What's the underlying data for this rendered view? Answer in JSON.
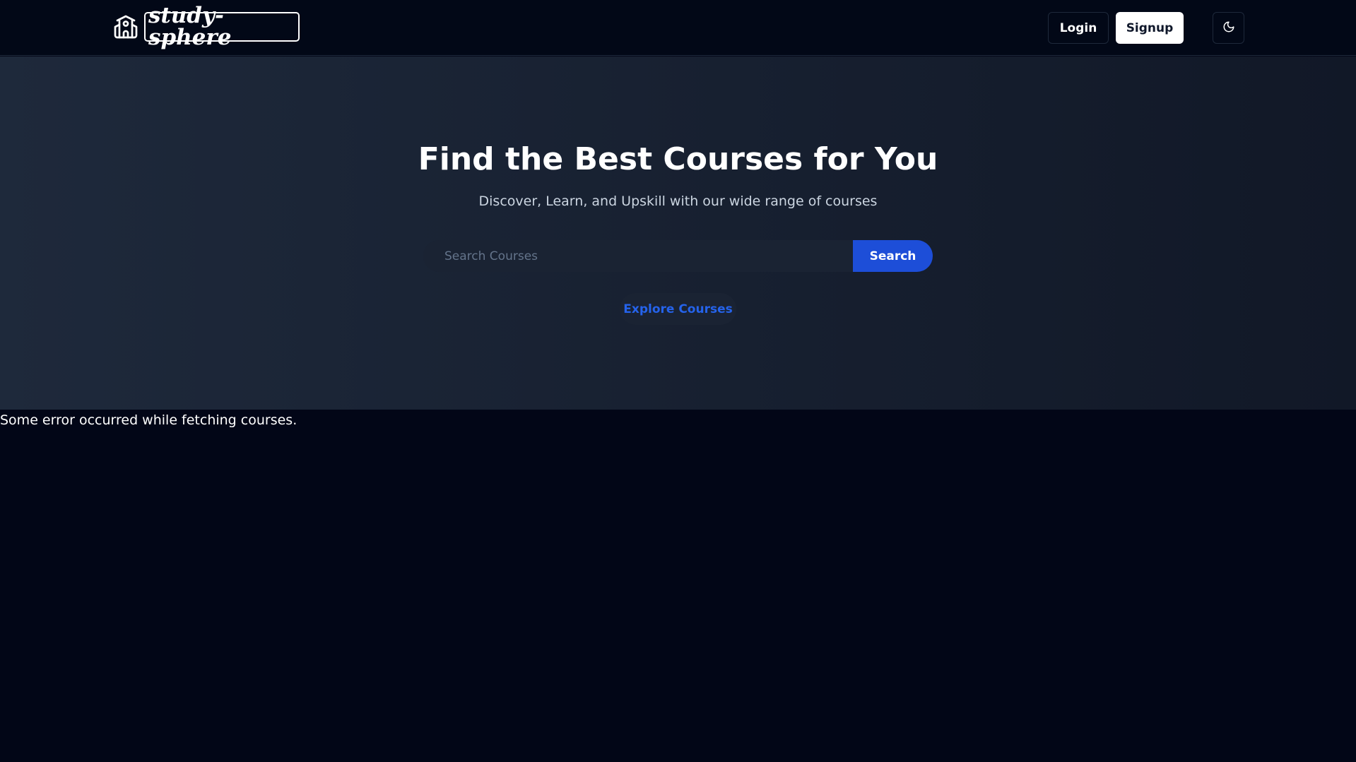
{
  "header": {
    "brand_name": "study-sphere",
    "brand_icon": "school-building-icon",
    "login_label": "Login",
    "signup_label": "Signup",
    "theme_icon": "moon-icon"
  },
  "hero": {
    "title": "Find the Best Courses for You",
    "subtitle": "Discover, Learn, and Upskill with our wide range of courses",
    "search": {
      "placeholder": "Search Courses",
      "value": "",
      "button_label": "Search"
    },
    "explore_label": "Explore Courses"
  },
  "status": {
    "error_message": "Some error occurred while fetching courses."
  },
  "colors": {
    "background": "#020617",
    "accent": "#1d4ed8",
    "link": "#2563eb"
  }
}
